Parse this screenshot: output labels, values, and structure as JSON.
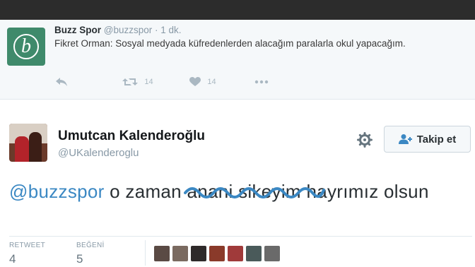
{
  "tweet1": {
    "logo_letter": "b",
    "name": "Buzz Spor",
    "handle": "@buzzspor",
    "separator": "·",
    "time": "1 dk.",
    "text": "Fikret Orman: Sosyal medyada küfredenlerden alacağım paralarla okul yapacağım.",
    "retweet_count": "14",
    "like_count": "14"
  },
  "tweet2": {
    "name": "Umutcan Kalenderoğlu",
    "handle": "@UKalenderoglu",
    "follow_label": "Takip et",
    "mention": "@buzzspor",
    "text_part1": "o zaman",
    "text_scribbled": "anani sikeyim",
    "text_part2": "hayrımız olsun",
    "retweet_label": "RETWEET",
    "retweet_value": "4",
    "like_label": "BEĞENİ",
    "like_value": "5"
  },
  "colors": {
    "mention": "#3b88c3",
    "scribble": "#3b88c3",
    "brand_logo": "#3f8a6b"
  },
  "icons": [
    "reply-icon",
    "retweet-icon",
    "heart-icon",
    "more-icon",
    "gear-icon",
    "add-user-icon"
  ]
}
